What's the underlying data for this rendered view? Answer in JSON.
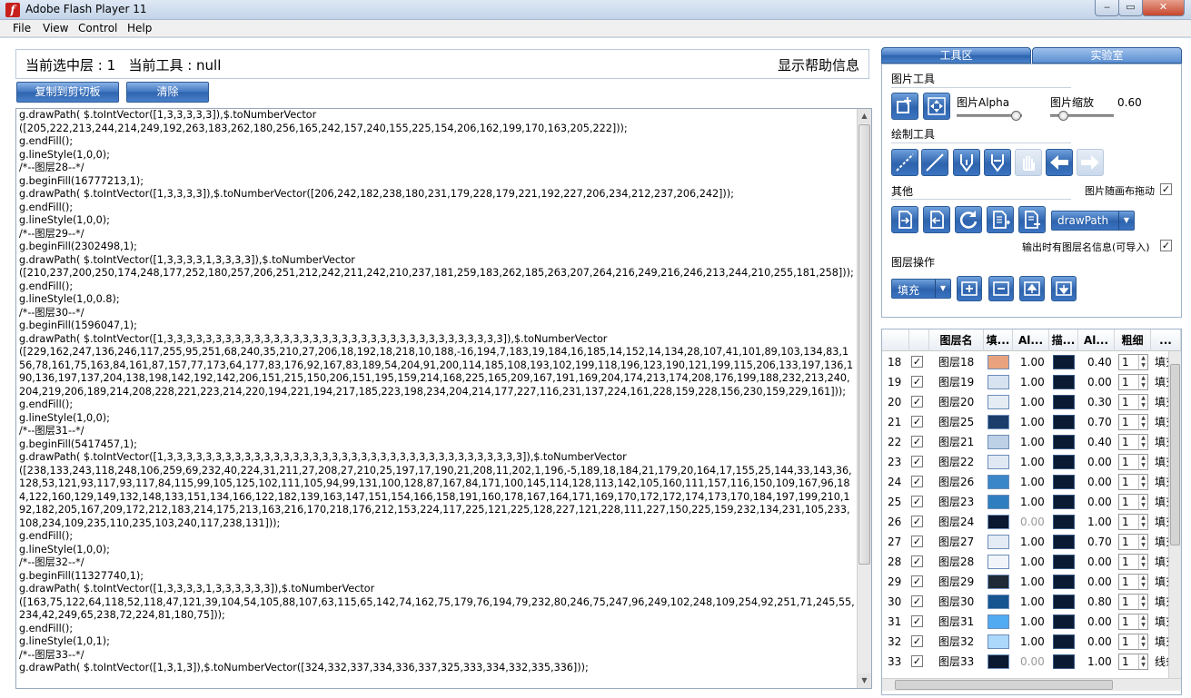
{
  "window": {
    "title": "Adobe Flash Player 11",
    "minimize": "‒",
    "maximize": "▭",
    "close": "✕"
  },
  "menu": [
    "File",
    "View",
    "Control",
    "Help"
  ],
  "status": {
    "text": "当前选中层 : 1   当前工具 : null",
    "help": "显示帮助信息"
  },
  "buttons": {
    "copy": "复制到剪切板",
    "clear": "清除"
  },
  "code": "g.drawPath( $.toIntVector([1,3,3,3,3,3]),$.toNumberVector\n([205,222,213,244,214,249,192,263,183,262,180,256,165,242,157,240,155,225,154,206,162,199,170,163,205,222]));\ng.endFill();\ng.lineStyle(1,0,0);\n/*--图层28--*/\ng.beginFill(16777213,1);\ng.drawPath( $.toIntVector([1,3,3,3,3]),$.toNumberVector([206,242,182,238,180,231,179,228,179,221,192,227,206,234,212,237,206,242]));\ng.endFill();\ng.lineStyle(1,0,0);\n/*--图层29--*/\ng.beginFill(2302498,1);\ng.drawPath( $.toIntVector([1,3,3,3,3,1,3,3,3,3]),$.toNumberVector\n([210,237,200,250,174,248,177,252,180,257,206,251,212,242,211,242,210,237,181,259,183,262,185,263,207,264,216,249,216,246,213,244,210,255,181,258]));\ng.endFill();\ng.lineStyle(1,0,0.8);\n/*--图层30--*/\ng.beginFill(1596047,1);\ng.drawPath( $.toIntVector([1,3,3,3,3,3,3,3,3,3,3,3,3,3,3,3,3,3,3,3,3,3,3,3,3,3,3,3,3,3,3,3,3,3,3,3]),$.toNumberVector\n([229,162,247,136,246,117,255,95,251,68,240,35,210,27,206,18,192,18,218,10,188,-16,194,7,183,19,184,16,185,14,152,14,134,28,107,41,101,89,103,134,83,156,78,161,75,163,84,161,87,157,77,173,64,177,83,176,92,167,83,189,54,204,91,200,114,185,108,193,102,199,118,196,123,190,121,199,115,206,133,197,136,190,136,197,137,204,138,198,142,192,142,206,151,215,150,206,151,195,159,214,168,225,165,209,167,191,169,204,174,213,174,208,176,199,188,232,213,240,204,219,206,189,214,208,228,221,223,214,220,194,221,194,217,185,223,198,234,204,214,177,227,116,231,137,224,161,228,159,228,156,230,159,229,161]));\ng.endFill();\ng.lineStyle(1,0,0);\n/*--图层31--*/\ng.beginFill(5417457,1);\ng.drawPath( $.toIntVector([1,3,3,3,3,3,3,3,3,3,3,3,3,3,3,3,3,3,3,3,3,3,3,3,3,3,3,3,3,3,3,3,3,3,3,3,3,3]),$.toNumberVector\n([238,133,243,118,248,106,259,69,232,40,224,31,211,27,208,27,210,25,197,17,190,21,208,11,202,1,196,-5,189,18,184,21,179,20,164,17,155,25,144,33,143,36,128,53,121,93,117,93,117,84,115,99,105,125,102,111,105,94,99,131,100,128,87,167,84,171,100,145,114,128,113,142,105,160,111,157,116,150,109,167,96,184,122,160,129,149,132,148,133,151,134,166,122,182,139,163,147,151,154,166,158,191,160,178,167,164,171,169,170,172,172,174,173,170,184,197,199,210,192,182,205,167,209,172,212,183,214,175,213,163,216,170,218,176,212,153,224,117,225,121,225,128,227,121,228,111,227,150,225,159,232,134,231,105,233,108,234,109,235,110,235,103,240,117,238,131]));\ng.endFill();\ng.lineStyle(1,0,0);\n/*--图层32--*/\ng.beginFill(11327740,1);\ng.drawPath( $.toIntVector([1,3,3,3,3,1,3,3,3,3,3,3]),$.toNumberVector\n([163,75,122,64,118,52,118,47,121,39,104,54,105,88,107,63,115,65,142,74,162,75,179,76,194,79,232,80,246,75,247,96,249,102,248,109,254,92,251,71,245,55,234,42,249,65,238,72,224,81,180,75]));\ng.endFill();\ng.lineStyle(1,0,1);\n/*--图层33--*/\ng.drawPath( $.toIntVector([1,3,1,3]),$.toNumberVector([324,332,337,334,336,337,325,333,334,332,335,336]));",
  "tabs": [
    "工具区",
    "实验室"
  ],
  "tools": {
    "image_tools_label": "图片工具",
    "alpha_label": "图片Alpha",
    "alpha_value": 0.9,
    "scale_label": "图片缩放",
    "scale_value": "0.60",
    "scale_level": 0.2,
    "draw_tools_label": "绘制工具",
    "other_label": "其他",
    "image_follow_label": "图片随画布拖动",
    "image_follow_checked": true,
    "draw_dropdown": "drawPath",
    "export_label": "输出时有图层名信息(可导入)",
    "export_checked": true,
    "layer_ops_label": "图层操作",
    "fill_dropdown": "填充"
  },
  "table": {
    "headers": [
      "",
      "",
      "图层名",
      "填...",
      "Al...",
      "描...",
      "Al...",
      "粗细",
      "..."
    ],
    "rows": [
      {
        "num": "18",
        "name": "图层18",
        "fill_color": "#e8a37e",
        "fill_alpha": "1.00",
        "stroke_alpha": "0.40",
        "thick": "1",
        "extra": "填充"
      },
      {
        "num": "19",
        "name": "图层19",
        "fill_color": "#d7e3f0",
        "fill_alpha": "1.00",
        "stroke_alpha": "0.00",
        "thick": "1",
        "extra": "填充"
      },
      {
        "num": "20",
        "name": "图层20",
        "fill_color": "#e4ecf4",
        "fill_alpha": "1.00",
        "stroke_alpha": "0.30",
        "thick": "1",
        "extra": "填充"
      },
      {
        "num": "21",
        "name": "图层25",
        "fill_color": "#1a3d6b",
        "fill_alpha": "1.00",
        "stroke_alpha": "0.70",
        "thick": "1",
        "extra": "填充"
      },
      {
        "num": "22",
        "name": "图层21",
        "fill_color": "#bcd0e6",
        "fill_alpha": "1.00",
        "stroke_alpha": "0.40",
        "thick": "1",
        "extra": "填充"
      },
      {
        "num": "23",
        "name": "图层22",
        "fill_color": "#e0e9f3",
        "fill_alpha": "1.00",
        "stroke_alpha": "0.00",
        "thick": "1",
        "extra": "填充"
      },
      {
        "num": "24",
        "name": "图层26",
        "fill_color": "#3a86c8",
        "fill_alpha": "1.00",
        "stroke_alpha": "0.00",
        "thick": "1",
        "extra": "填充"
      },
      {
        "num": "25",
        "name": "图层23",
        "fill_color": "#2f7fbf",
        "fill_alpha": "1.00",
        "stroke_alpha": "0.00",
        "thick": "1",
        "extra": "填充"
      },
      {
        "num": "26",
        "name": "图层24",
        "fill_color": "#0a1830",
        "fill_alpha": "0.00",
        "stroke_alpha": "1.00",
        "thick": "1",
        "extra": "填充"
      },
      {
        "num": "27",
        "name": "图层27",
        "fill_color": "#e3ebf4",
        "fill_alpha": "1.00",
        "stroke_alpha": "0.70",
        "thick": "1",
        "extra": "填充"
      },
      {
        "num": "28",
        "name": "图层28",
        "fill_color": "#f1f5fa",
        "fill_alpha": "1.00",
        "stroke_alpha": "0.00",
        "thick": "1",
        "extra": "填充"
      },
      {
        "num": "29",
        "name": "图层29",
        "fill_color": "#1f2a36",
        "fill_alpha": "1.00",
        "stroke_alpha": "0.00",
        "thick": "1",
        "extra": "填充"
      },
      {
        "num": "30",
        "name": "图层30",
        "fill_color": "#16558f",
        "fill_alpha": "1.00",
        "stroke_alpha": "0.80",
        "thick": "1",
        "extra": "填充"
      },
      {
        "num": "31",
        "name": "图层31",
        "fill_color": "#52aaf1",
        "fill_alpha": "1.00",
        "stroke_alpha": "0.00",
        "thick": "1",
        "extra": "填充"
      },
      {
        "num": "32",
        "name": "图层32",
        "fill_color": "#acd8fc",
        "fill_alpha": "1.00",
        "stroke_alpha": "0.00",
        "thick": "1",
        "extra": "填充"
      },
      {
        "num": "33",
        "name": "图层33",
        "fill_color": "#0a1830",
        "fill_alpha": "0.00",
        "stroke_alpha": "1.00",
        "thick": "1",
        "extra": "线条"
      }
    ]
  },
  "icons": {
    "flash": "f",
    "up": "▲",
    "down": "▼",
    "check": "✓"
  }
}
